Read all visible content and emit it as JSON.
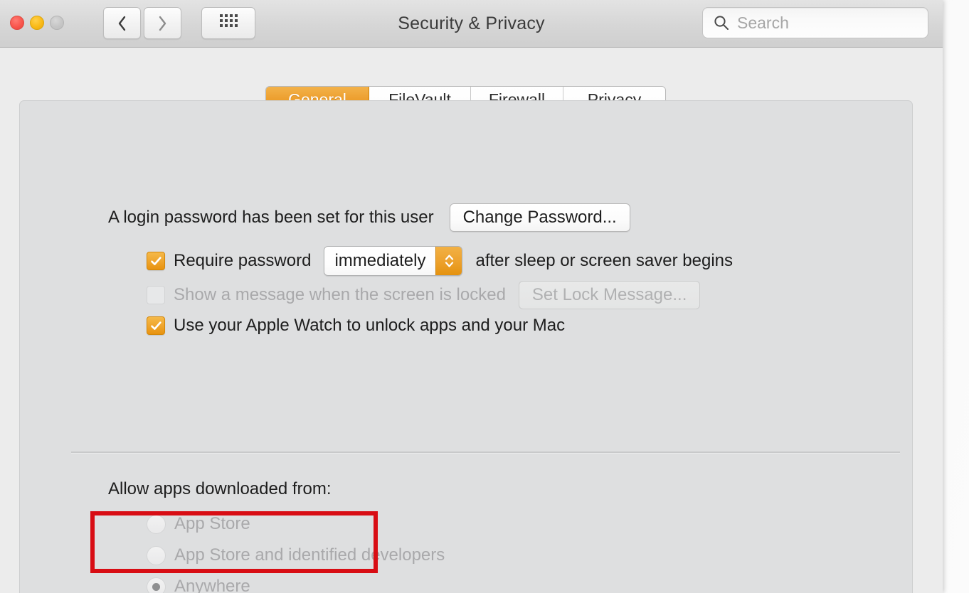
{
  "window": {
    "title": "Security & Privacy",
    "traffic_lights": [
      {
        "name": "close",
        "color": "#f9564d"
      },
      {
        "name": "minimize",
        "color": "#f9ba17"
      },
      {
        "name": "zoom",
        "color": "#c6c6c6"
      }
    ],
    "nav": {
      "back_label": "‹",
      "forward_label": "›",
      "show_all_label": "grid-icon"
    }
  },
  "search": {
    "placeholder": "Search",
    "value": "",
    "icon": "search-icon"
  },
  "tabs": [
    {
      "label": "General",
      "active": true
    },
    {
      "label": "FileVault",
      "active": false
    },
    {
      "label": "Firewall",
      "active": false
    },
    {
      "label": "Privacy",
      "active": false
    }
  ],
  "general": {
    "password_status": "A login password has been set for this user",
    "change_password_button": "Change Password...",
    "require_password": {
      "label": "Require password",
      "checked": true,
      "delay_value": "immediately",
      "suffix": "after sleep or screen saver begins"
    },
    "lock_message": {
      "label": "Show a message when the screen is locked",
      "checked": false,
      "disabled": true,
      "button": "Set Lock Message..."
    },
    "apple_watch": {
      "label": "Use your Apple Watch to unlock apps and your Mac",
      "checked": true
    },
    "allow_apps": {
      "title": "Allow apps downloaded from:",
      "options": [
        {
          "label": "App Store",
          "selected": false,
          "disabled": true
        },
        {
          "label": "App Store and identified developers",
          "selected": false,
          "disabled": true
        },
        {
          "label": "Anywhere",
          "selected": true,
          "disabled": true,
          "highlighted": true
        }
      ]
    }
  },
  "annotation": {
    "color": "#d80d14",
    "target": "Anywhere"
  }
}
